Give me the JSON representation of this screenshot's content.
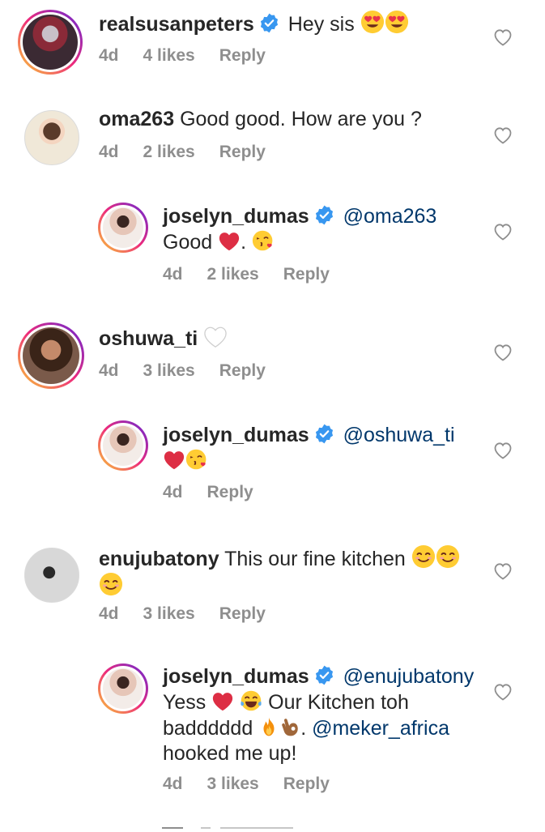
{
  "comments": [
    {
      "username": "realsusanpeters",
      "verified": true,
      "text": "Hey sis",
      "emojis": "heart-eyes x2",
      "time": "4d",
      "likes": "4 likes",
      "reply": "Reply"
    },
    {
      "username": "oma263",
      "verified": false,
      "text": "Good good. How are you ?",
      "time": "4d",
      "likes": "2 likes",
      "reply": "Reply"
    },
    {
      "username": "joselyn_dumas",
      "verified": true,
      "mention": "@oma263",
      "text": "Good",
      "text_tail": ".",
      "time": "4d",
      "likes": "2 likes",
      "reply": "Reply"
    },
    {
      "username": "oshuwa_ti",
      "verified": false,
      "time": "4d",
      "likes": "3 likes",
      "reply": "Reply"
    },
    {
      "username": "joselyn_dumas",
      "verified": true,
      "mention": "@oshuwa_ti",
      "time": "4d",
      "reply": "Reply"
    },
    {
      "username": "enujubatony",
      "verified": false,
      "text": "This our fine kitchen",
      "time": "4d",
      "likes": "3 likes",
      "reply": "Reply"
    },
    {
      "username": "joselyn_dumas",
      "verified": true,
      "mention": "@enujubatony",
      "text_a": "Yess",
      "text_b": "Our Kitchen toh",
      "text_c": "badddddd",
      "text_d": ".",
      "mention2": "@meker_africa",
      "text_e": "hooked me up!",
      "time": "4d",
      "likes": "3 likes",
      "reply": "Reply"
    }
  ],
  "colors": {
    "username": "#262626",
    "mention": "#00376b",
    "meta": "#8e8e8e",
    "verified": "#3897f0"
  }
}
